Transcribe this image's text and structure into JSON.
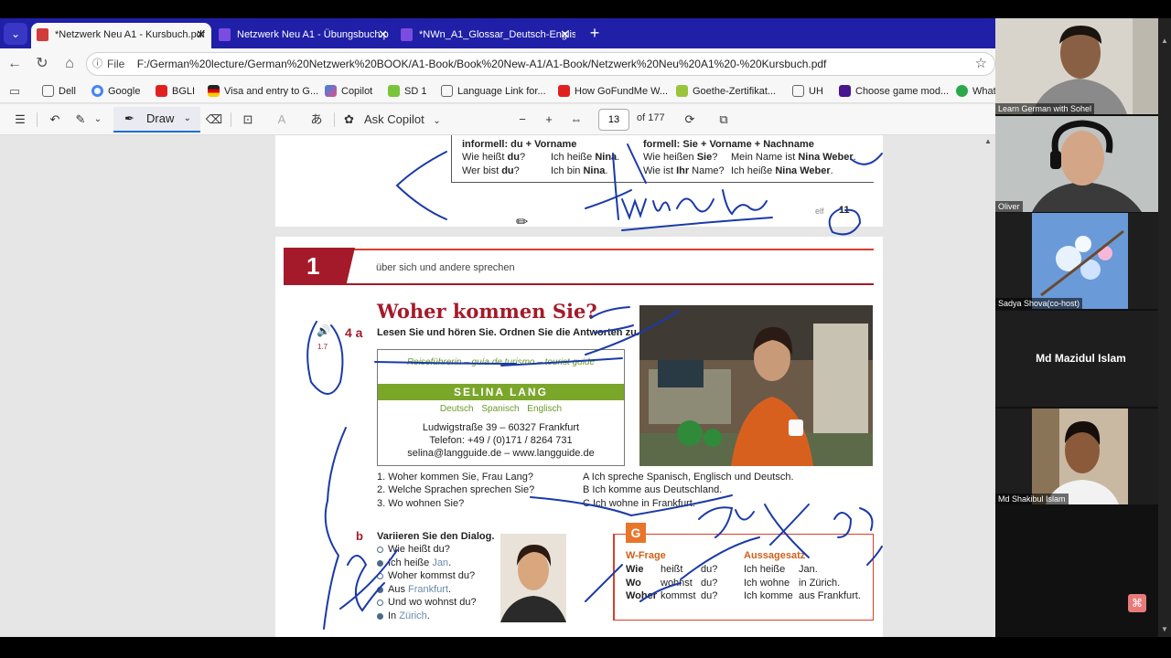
{
  "tabs": [
    {
      "label": "*Netzwerk Neu A1 - Kursbuch.pdf",
      "close": "✕"
    },
    {
      "label": "Netzwerk Neu A1 - Übungsbuch.p",
      "close": "✕"
    },
    {
      "label": "*NWn_A1_Glossar_Deutsch-Englis",
      "close": "✕"
    }
  ],
  "tab_menu_glyph": "⌄",
  "new_tab_glyph": "+",
  "address": {
    "scheme_label": "File",
    "url": "F:/German%20lecture/German%20Netzwerk%20BOOK/A1-Book/Book%20New-A1/A1-Book/Netzwerk%20Neu%20A1%20-%20Kursbuch.pdf"
  },
  "bookmarks": [
    {
      "label": "Dell",
      "icon": "folder-icon",
      "color": "#777777"
    },
    {
      "label": "Google",
      "icon": "google-icon",
      "color": "#4285f4"
    },
    {
      "label": "BGLI",
      "icon": "youtube-icon",
      "color": "#e02020"
    },
    {
      "label": "Visa and entry to G...",
      "icon": "flag-icon",
      "color": "#333333"
    },
    {
      "label": "Copilot",
      "icon": "copilot-icon",
      "color": "#6a8ad8"
    },
    {
      "label": "SD 1",
      "icon": "sd-icon",
      "color": "#7ac43a"
    },
    {
      "label": "Language Link for...",
      "icon": "folder-icon",
      "color": "#777777"
    },
    {
      "label": "How GoFundMe W...",
      "icon": "play-icon",
      "color": "#e02020"
    },
    {
      "label": "Goethe-Zertifikat...",
      "icon": "goethe-icon",
      "color": "#9ac43a"
    },
    {
      "label": "UH",
      "icon": "folder-icon",
      "color": "#777777"
    },
    {
      "label": "Choose game mod...",
      "icon": "kahoot-icon",
      "color": "#46178f"
    },
    {
      "label": "What",
      "icon": "whatsapp-icon",
      "color": "#2aa84a"
    }
  ],
  "toolbar": {
    "draw_label": "Draw",
    "copilot_label": "Ask Copilot",
    "page_current": "13",
    "page_total": "of 177"
  },
  "page_top": {
    "header_left": "informell: du + Vorname",
    "header_right": "formell: Sie + Vorname + Nachname",
    "rows": [
      {
        "q1": "Wie heißt ",
        "q1b": "du",
        "q1e": "?",
        "a1": "Ich heiße ",
        "a1b": "Nina",
        "a1e": ".",
        "q2": "Wie heißen ",
        "q2b": "Sie",
        "q2e": "?",
        "a2": "Mein Name ist ",
        "a2b": "Nina Weber",
        "a2e": "."
      },
      {
        "q1": "Wer bist ",
        "q1b": "du",
        "q1e": "?",
        "a1": "Ich bin ",
        "a1b": "Nina",
        "a1e": ".",
        "q2": "Wie ist ",
        "q2b": "Ihr",
        "q2e": " Name?",
        "a2": "Ich heiße ",
        "a2b": "Nina Weber",
        "a2e": "."
      }
    ],
    "footer_word": "elf",
    "footer_num": "11"
  },
  "page_main": {
    "chapter": "1",
    "chapter_sub": "über sich und andere sprechen",
    "title": "Woher kommen Sie?",
    "exercise": "4 a",
    "track": "1.7",
    "instruction": "Lesen Sie und hören Sie. Ordnen Sie die Antworten zu.",
    "card": {
      "role": "Reiseführerin – guía de turismo – tourist guide",
      "name": "SELINA LANG",
      "langs": "Deutsch  Spanisch  Englisch",
      "line1": "Ludwigstraße 39 – 60327 Frankfurt",
      "line2": "Telefon: +49 / (0)171 / 8264 731",
      "line3": "selina@langguide.de – www.langguide.de"
    },
    "questions": [
      "1.  Woher kommen Sie, Frau Lang?",
      "2.  Welche Sprachen sprechen Sie?",
      "3.  Wo wohnen Sie?"
    ],
    "answers": [
      "A  Ich spreche Spanisch, Englisch und Deutsch.",
      "B  Ich komme aus Deutschland.",
      "C  Ich wohne in Frankfurt."
    ],
    "dialog_letter": "b",
    "dialog_title": "Variieren Sie den Dialog.",
    "dialog": [
      {
        "pre": "Wie heißt du?",
        "hl": "",
        "post": "",
        "filled": false
      },
      {
        "pre": "Ich heiße ",
        "hl": "Jan",
        "post": ".",
        "filled": true
      },
      {
        "pre": "Woher kommst du?",
        "hl": "",
        "post": "",
        "filled": false
      },
      {
        "pre": "Aus ",
        "hl": "Frankfurt",
        "post": ".",
        "filled": true
      },
      {
        "pre": "Und wo wohnst du?",
        "hl": "",
        "post": "",
        "filled": false
      },
      {
        "pre": "In ",
        "hl": "Zürich",
        "post": ".",
        "filled": true
      }
    ],
    "grammar_badge": "G",
    "grammar": {
      "head_left": "W-Frage",
      "head_right": "Aussagesatz",
      "rows": [
        {
          "w": "Wie",
          "v": "heißt",
          "s": "du?",
          "a1": "Ich heiße",
          "a2": "Jan."
        },
        {
          "w": "Wo",
          "v": "wohnst",
          "s": "du?",
          "a1": "Ich wohne",
          "a2": "in Zürich."
        },
        {
          "w": "Woher",
          "v": "kommst",
          "s": "du?",
          "a1": "Ich komme",
          "a2": "aus Frankfurt."
        }
      ]
    }
  },
  "participants": [
    {
      "name": "Learn German with Sohel",
      "bg": "#d8d4cc"
    },
    {
      "name": "Oliver",
      "bg": "#bfc3c2"
    },
    {
      "name": "Sadya Shova(co-host)",
      "bg": "#6a9ad8"
    },
    {
      "name": "Md Mazidul Islam",
      "bg": "#1e1e1e"
    },
    {
      "name": "Md Shakibul Islam",
      "bg": "#c9b9a3"
    }
  ],
  "acrobat_glyph": "⌘"
}
